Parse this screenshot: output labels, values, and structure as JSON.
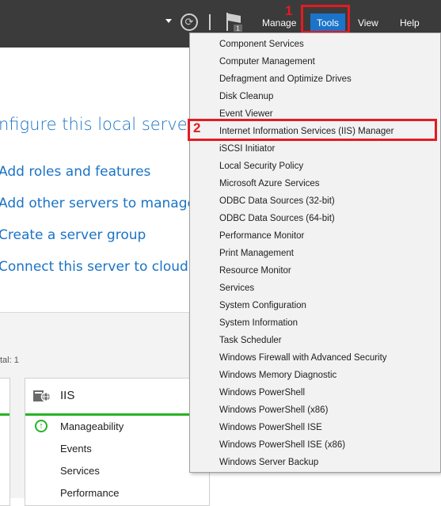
{
  "topbar": {
    "menu": {
      "manage": "Manage",
      "tools": "Tools",
      "view": "View",
      "help": "Help"
    },
    "notification_count": "1",
    "step1": "1"
  },
  "page": {
    "title": "nfigure this local server",
    "links": [
      "Add roles and features",
      "Add other servers to manage",
      "Create a server group",
      "Connect this server to cloud ser"
    ],
    "total": "tal: 1"
  },
  "tile": {
    "title": "IIS",
    "rows": [
      "Manageability",
      "Events",
      "Services",
      "Performance"
    ]
  },
  "tools_menu": {
    "step2": "2",
    "items": [
      "Component Services",
      "Computer Management",
      "Defragment and Optimize Drives",
      "Disk Cleanup",
      "Event Viewer",
      "Internet Information Services (IIS) Manager",
      "iSCSI Initiator",
      "Local Security Policy",
      "Microsoft Azure Services",
      "ODBC Data Sources (32-bit)",
      "ODBC Data Sources (64-bit)",
      "Performance Monitor",
      "Print Management",
      "Resource Monitor",
      "Services",
      "System Configuration",
      "System Information",
      "Task Scheduler",
      "Windows Firewall with Advanced Security",
      "Windows Memory Diagnostic",
      "Windows PowerShell",
      "Windows PowerShell (x86)",
      "Windows PowerShell ISE",
      "Windows PowerShell ISE (x86)",
      "Windows Server Backup"
    ]
  },
  "colors": {
    "accent": "#1a74c9",
    "highlight": "#e31b23",
    "ok": "#27b325"
  }
}
